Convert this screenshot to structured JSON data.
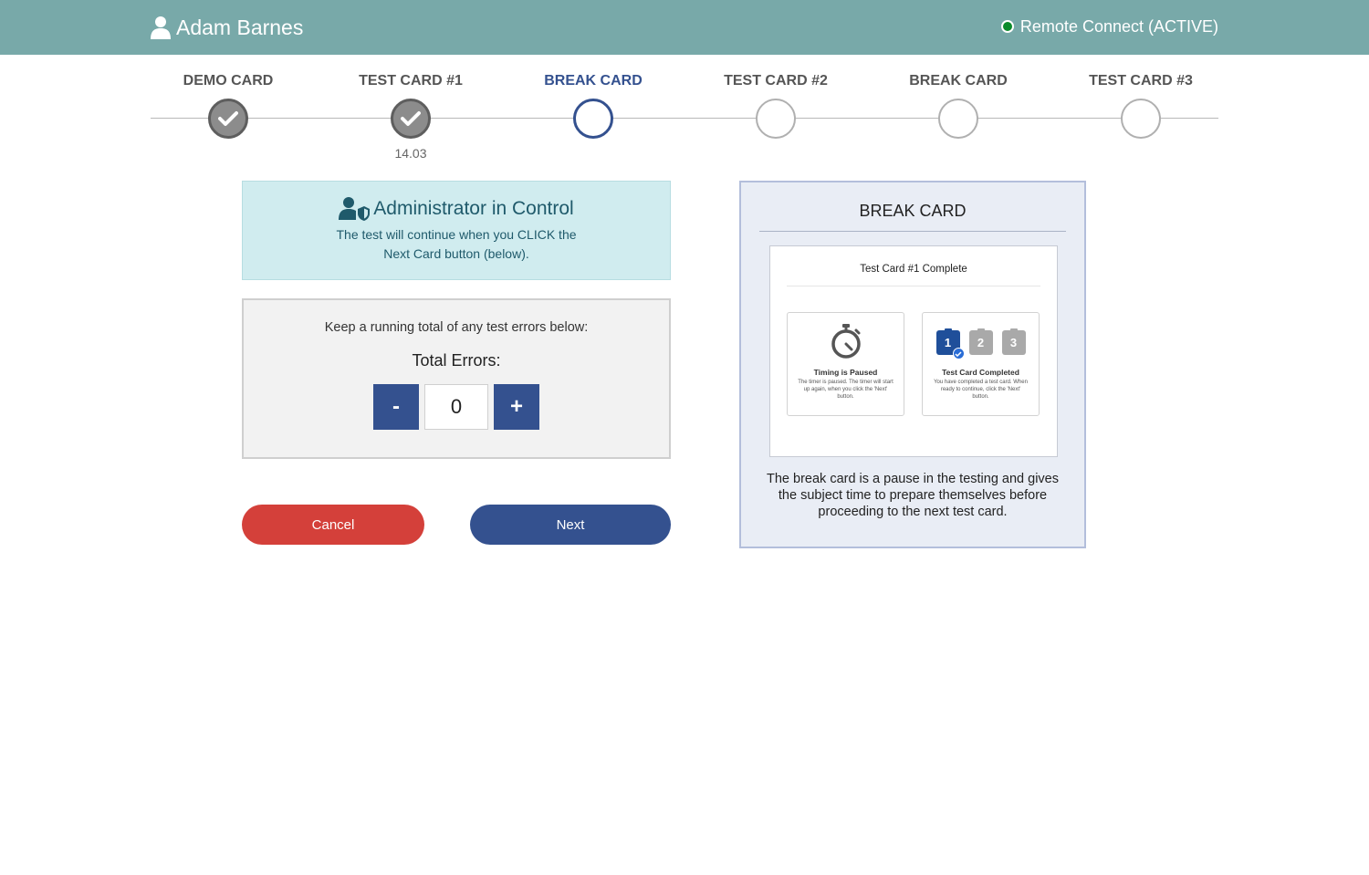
{
  "header": {
    "user_name": "Adam Barnes",
    "remote_status": "Remote Connect (ACTIVE)",
    "status_color": "#0a8a2a"
  },
  "stepper": {
    "steps": [
      {
        "label": "DEMO CARD",
        "state": "done",
        "time": ""
      },
      {
        "label": "TEST CARD #1",
        "state": "done",
        "time": "14.03"
      },
      {
        "label": "BREAK CARD",
        "state": "current",
        "time": ""
      },
      {
        "label": "TEST CARD #2",
        "state": "pending",
        "time": ""
      },
      {
        "label": "BREAK CARD",
        "state": "pending",
        "time": ""
      },
      {
        "label": "TEST CARD #3",
        "state": "pending",
        "time": ""
      }
    ]
  },
  "admin": {
    "title": "Administrator in Control",
    "line1": "The test will continue when you CLICK the",
    "line2": "Next Card button (below)."
  },
  "errors": {
    "hint": "Keep a running total of any test errors below:",
    "label": "Total Errors:",
    "minus": "-",
    "plus": "+",
    "value": "0"
  },
  "actions": {
    "cancel": "Cancel",
    "next": "Next"
  },
  "panel": {
    "title": "BREAK CARD",
    "preview_title": "Test Card #1 Complete",
    "mini_a": {
      "icon": "stopwatch-icon",
      "heading": "Timing is Paused",
      "text": "The timer is paused. The timer will start up again, when you click the 'Next' button."
    },
    "mini_b": {
      "icon": "clipboard-icon",
      "clip1": "1",
      "clip2": "2",
      "clip3": "3",
      "heading": "Test Card Completed",
      "text": "You have completed a test card. When ready to continue, click the 'Next' button."
    },
    "description": "The break card is a pause in the testing and gives the subject time to prepare themselves before proceeding to the next test card."
  },
  "colors": {
    "header_bg": "#78a9a9",
    "primary": "#34518f",
    "danger": "#d4403a",
    "admin_bg": "#d0ecef"
  }
}
